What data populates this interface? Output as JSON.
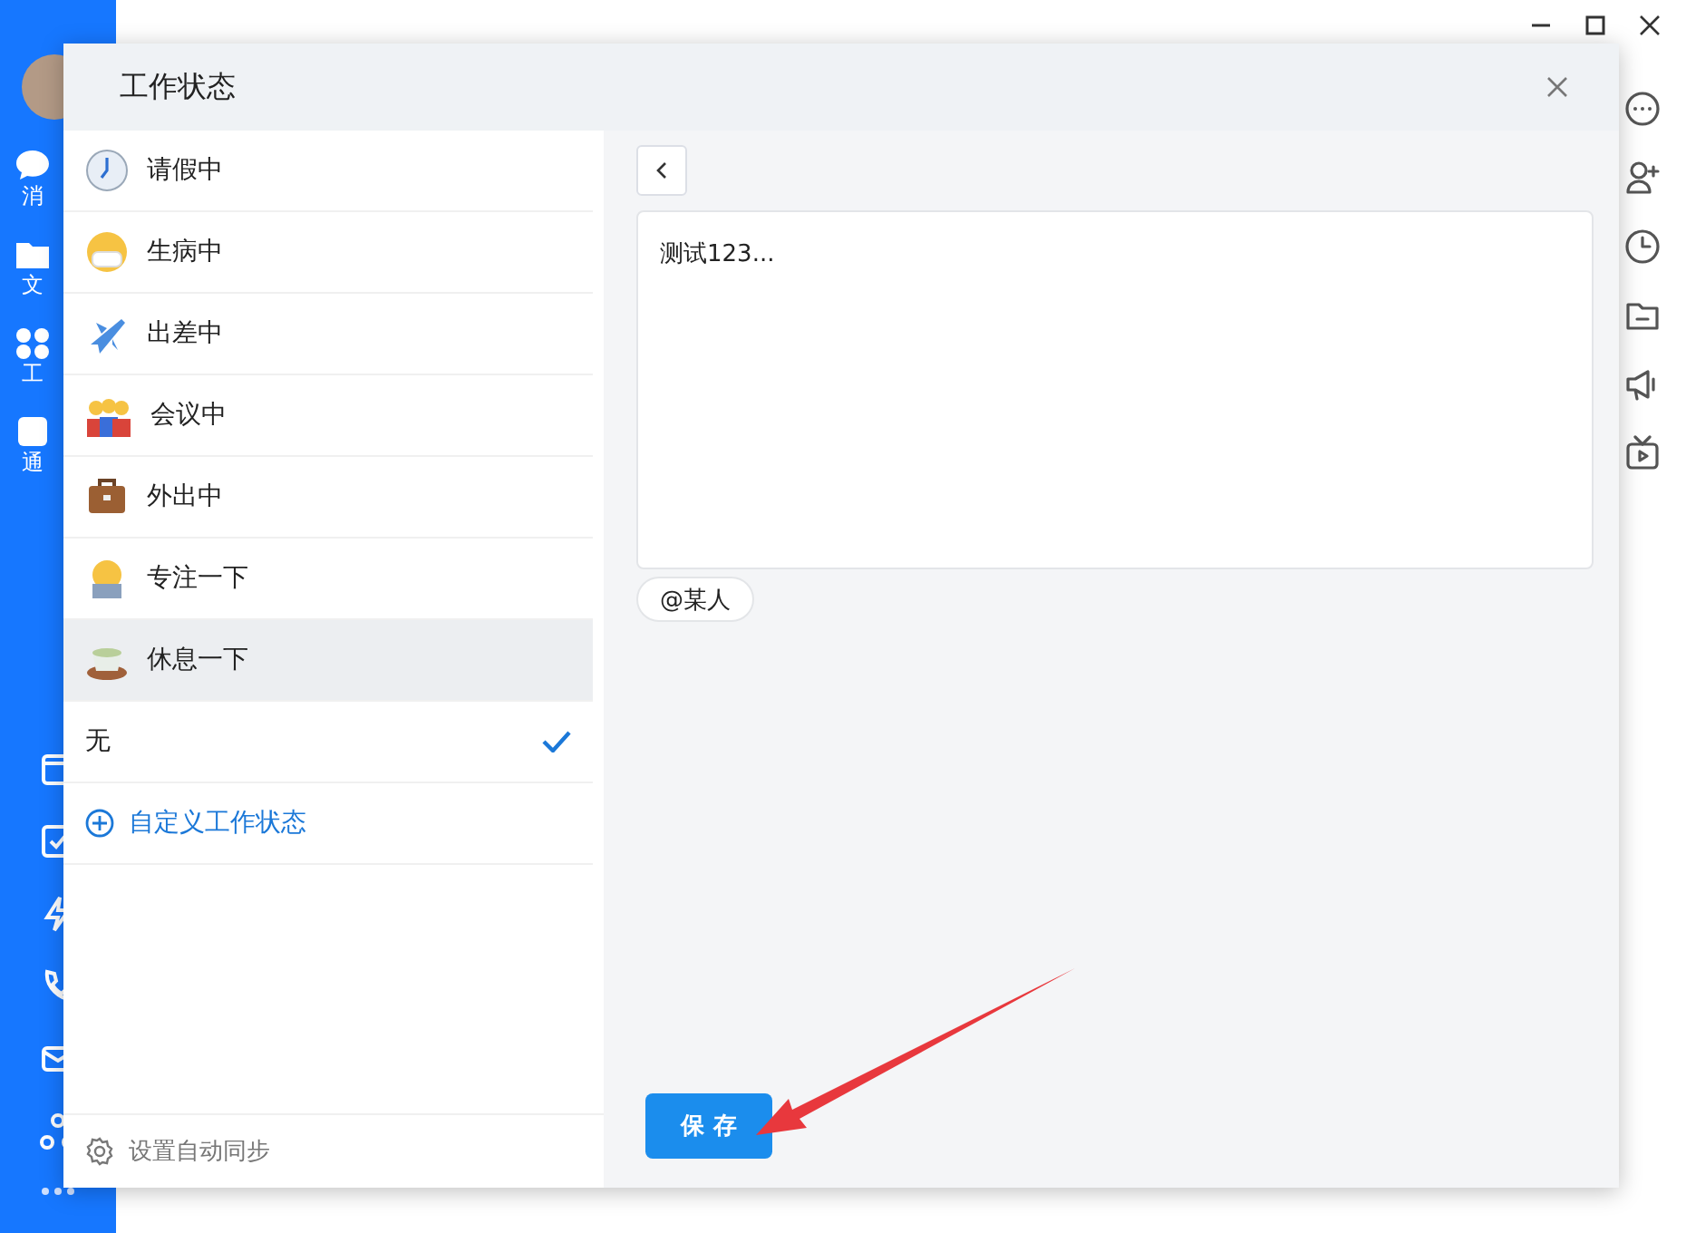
{
  "sidebar": {
    "items": [
      {
        "label": "消"
      },
      {
        "label": "文"
      },
      {
        "label": "工"
      },
      {
        "label": "通"
      }
    ]
  },
  "dialog": {
    "title": "工作状态",
    "statuses": [
      {
        "label": "请假中",
        "hovered": false,
        "selected": false
      },
      {
        "label": "生病中",
        "hovered": false,
        "selected": false
      },
      {
        "label": "出差中",
        "hovered": false,
        "selected": false
      },
      {
        "label": "会议中",
        "hovered": false,
        "selected": false
      },
      {
        "label": "外出中",
        "hovered": false,
        "selected": false
      },
      {
        "label": "专注一下",
        "hovered": false,
        "selected": false
      },
      {
        "label": "休息一下",
        "hovered": true,
        "selected": false
      },
      {
        "label": "无",
        "hovered": false,
        "selected": true
      }
    ],
    "custom_link": "自定义工作状态",
    "sync_setting": "设置自动同步",
    "message": "测试123...",
    "mention": "@某人",
    "save_button": "保 存"
  }
}
